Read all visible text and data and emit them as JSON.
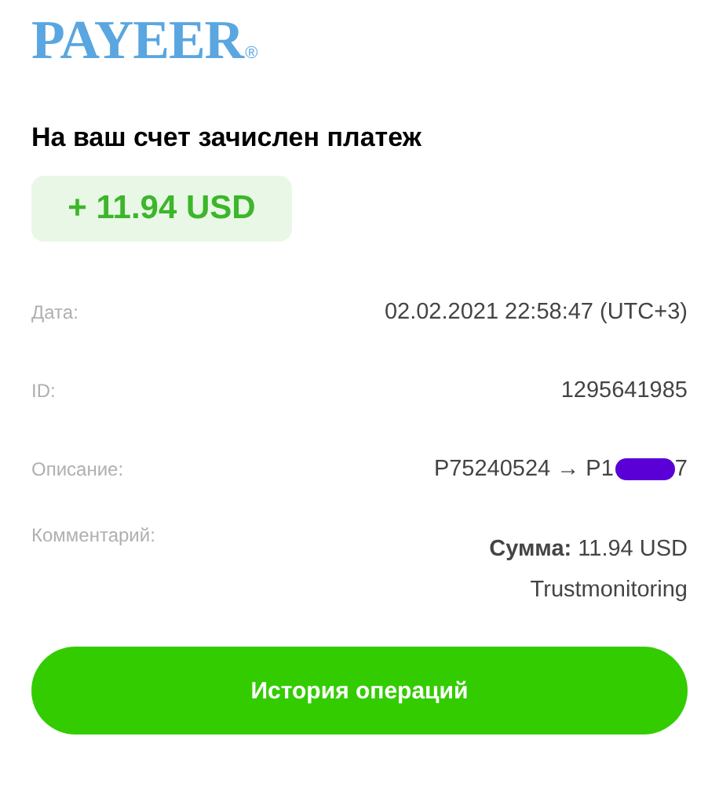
{
  "logo": {
    "text": "PAYEER",
    "mark": "®"
  },
  "heading": "На ваш счет зачислен платеж",
  "amount": "+ 11.94 USD",
  "details": [
    {
      "label": "Дата:",
      "kind": "text",
      "value": "02.02.2021 22:58:47 (UTC+3)"
    },
    {
      "label": "ID:",
      "kind": "text",
      "value": "1295641985"
    },
    {
      "label": "Описание:",
      "kind": "redacted",
      "before": "P75240524 → P1",
      "after": "7"
    },
    {
      "label": "Комментарий:",
      "kind": "comment",
      "lines": [
        "**Сумма:** 11.94 USD",
        "Trustmonitoring"
      ]
    }
  ],
  "button": "История операций"
}
